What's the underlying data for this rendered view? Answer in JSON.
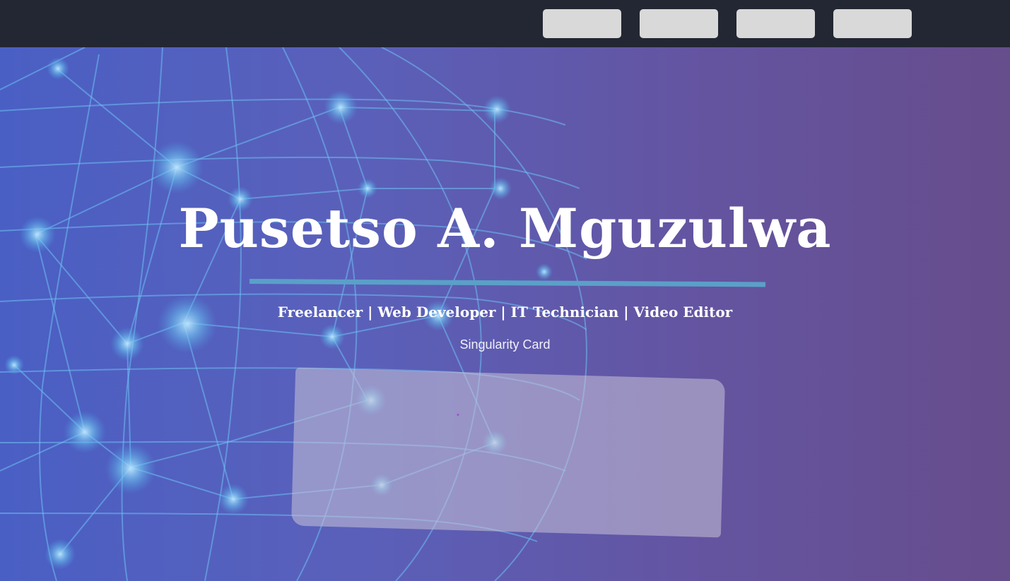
{
  "nav": {
    "buttons": [
      "",
      "",
      "",
      ""
    ]
  },
  "hero": {
    "name": "Pusetso A. Mguzulwa",
    "tagline": "Freelancer | Web Developer | IT Technician | Video Editor",
    "card_caption": "Singularity Card"
  },
  "colors": {
    "navbar": "#232733",
    "nav_button": "#d9d9d9",
    "rule": "#5aa0c8",
    "gradient_start": "#4a5fc4",
    "gradient_end": "#664d8c"
  }
}
